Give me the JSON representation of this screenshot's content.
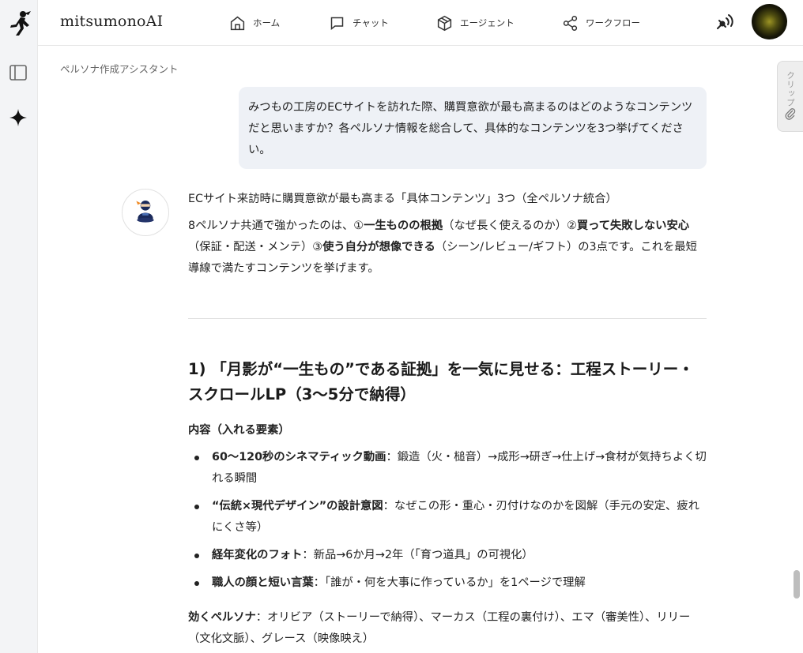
{
  "app": {
    "brand": "mitsumonoAI"
  },
  "nav": {
    "home": "ホーム",
    "chat": "チャット",
    "agent": "エージェント",
    "workflow": "ワークフロー"
  },
  "breadcrumb": "ペルソナ作成アシスタント",
  "clip_label": "クリップ",
  "user_message": "みつもの工房のECサイトを訪れた際、購買意欲が最も高まるのはどのようなコンテンツだと思いますか？各ペルソナ情報を総合して、具体的なコンテンツを3つ挙げてください。",
  "answer": {
    "intro": "ECサイト来訪時に購買意欲が最も高まる「具体コンテンツ」3つ（全ペルソナ統合）",
    "p_a": "8ペルソナ共通で強かったのは、①",
    "p_b1": "一生ものの根拠",
    "p_c": "（なぜ長く使えるのか）②",
    "p_b2": "買って失敗しない安心",
    "p_d": "（保証・配送・メンテ）③",
    "p_b3": "使う自分が想像できる",
    "p_e": "（シーン/レビュー/ギフト）の3点です。これを最短導線で満たすコンテンツを挙げます。",
    "section_title": "1) 「月影が“一生もの”である証拠」を一気に見せる：工程ストーリー・スクロールLP（3〜5分で納得）",
    "content_label": "内容（入れる要素）",
    "bullets": [
      {
        "bold": "60〜120秒のシネマティック動画",
        "text": "：鍛造（火・槌音）→成形→研ぎ→仕上げ→食材が気持ちよく切れる瞬間"
      },
      {
        "bold": "“伝統×現代デザイン”の設計意図",
        "text": "：なぜこの形・重心・刃付けなのかを図解（手元の安定、疲れにくさ等）"
      },
      {
        "bold": "経年変化のフォト",
        "text": "：新品→6か月→2年（「育つ道具」の可視化）"
      },
      {
        "bold": "職人の顔と短い言葉",
        "text": "：「誰が・何を大事に作っているか」を1ページで理解"
      }
    ],
    "effective_label": "効くペルソナ",
    "effective_text": "：オリビア（ストーリーで納得）、マーカス（工程の裏付け）、エマ（審美性）、リリー（文化文脈）、グレース（映像映え）"
  }
}
